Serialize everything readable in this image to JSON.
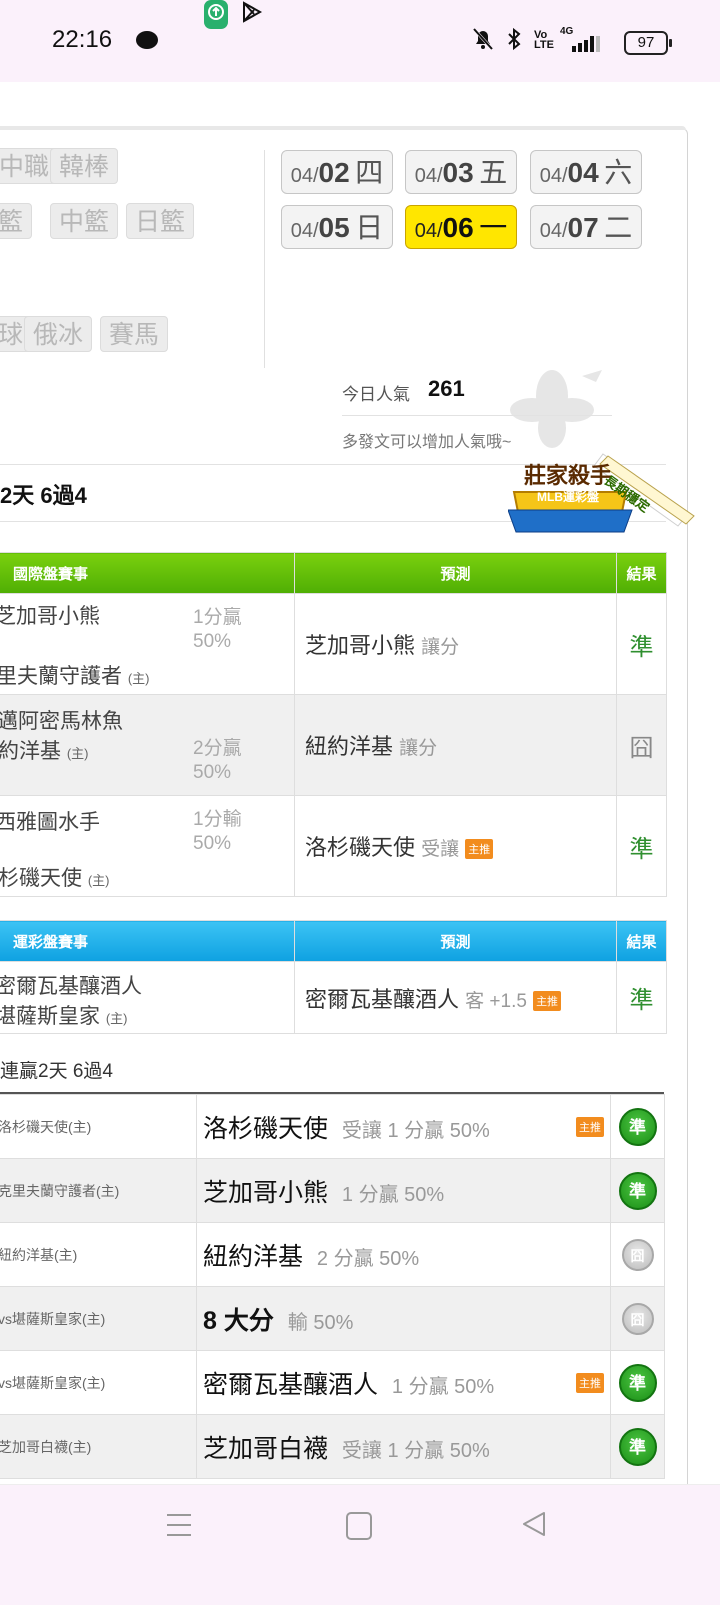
{
  "status_bar": {
    "time": "22:16",
    "battery": "97",
    "network": "4G",
    "icons": [
      "chat-bubble-icon",
      "app-green-icon",
      "upload-icon",
      "play-store-icon",
      "mute-icon",
      "bluetooth-icon",
      "volte-icon",
      "signal-icon",
      "battery-icon"
    ]
  },
  "league_tags": [
    {
      "label": "中職"
    },
    {
      "label": "韓棒"
    },
    {
      "label": "美籃"
    },
    {
      "label": "中籃"
    },
    {
      "label": "日籃"
    },
    {
      "label": "冰球"
    },
    {
      "label": "俄冰"
    },
    {
      "label": "賽馬"
    }
  ],
  "dates": [
    {
      "month": "04/",
      "day": "02",
      "weekday": "四",
      "active": false
    },
    {
      "month": "04/",
      "day": "03",
      "weekday": "五",
      "active": false
    },
    {
      "month": "04/",
      "day": "04",
      "weekday": "六",
      "active": false
    },
    {
      "month": "04/",
      "day": "05",
      "weekday": "日",
      "active": false
    },
    {
      "month": "04/",
      "day": "06",
      "weekday": "一",
      "active": true
    },
    {
      "month": "04/",
      "day": "07",
      "weekday": "二",
      "active": false
    }
  ],
  "popularity": {
    "label": "今日人氣",
    "value": "261",
    "hint": "多發文可以增加人氣哦~"
  },
  "streak": "2天 6過4",
  "badge": {
    "title": "莊家殺手",
    "subtitle": "MLB運彩盤",
    "ribbon": "長期穩定"
  },
  "intl_table": {
    "headers": [
      "國際盤賽事",
      "預測",
      "結果"
    ],
    "rows": [
      {
        "team1": "芝加哥小熊",
        "team2": "克里夫蘭守護者",
        "home": "(主)",
        "odds1": "1分贏",
        "odds2": "50%",
        "pick": "芝加哥小熊",
        "pick_sub": "讓分",
        "hot": "",
        "result": "準"
      },
      {
        "team1": "邁阿密馬林魚",
        "team2": "紐約洋基",
        "home": "(主)",
        "odds1": "2分贏",
        "odds2": "50%",
        "pick": "紐約洋基",
        "pick_sub": "讓分",
        "hot": "",
        "result": "囧"
      },
      {
        "team1": "西雅圖水手",
        "team2": "洛杉磯天使",
        "home": "(主)",
        "odds1": "1分輸",
        "odds2": "50%",
        "pick": "洛杉磯天使",
        "pick_sub": "受讓",
        "hot": "主推",
        "result": "準"
      }
    ]
  },
  "sports_table": {
    "headers": [
      "運彩盤賽事",
      "預測",
      "結果"
    ],
    "rows": [
      {
        "team1": "密爾瓦基釀酒人",
        "team2": "堪薩斯皇家",
        "home": "(主)",
        "pick": "密爾瓦基釀酒人",
        "pick_sub": "客 +1.5",
        "hot": "主推",
        "result": "準"
      }
    ]
  },
  "history": {
    "title": "連贏2天 6過4",
    "rows": [
      {
        "game": "洛杉磯天使(主)",
        "pick": "洛杉磯天使",
        "sub": "受讓 1 分贏 50%",
        "hot": "主推",
        "result": "準",
        "win": true
      },
      {
        "game": "克里夫蘭守護者(主)",
        "pick": "芝加哥小熊",
        "sub": "1 分贏 50%",
        "hot": "",
        "result": "準",
        "win": true
      },
      {
        "game": "紐約洋基(主)",
        "pick": "紐約洋基",
        "sub": "2 分贏 50%",
        "hot": "",
        "result": "囧",
        "win": false
      },
      {
        "game": "vs堪薩斯皇家(主)",
        "pick": "8 大分",
        "sub": "輸 50%",
        "hot": "",
        "result": "囧",
        "win": false
      },
      {
        "game": "vs堪薩斯皇家(主)",
        "pick": "密爾瓦基釀酒人",
        "sub": "1 分贏 50%",
        "hot": "主推",
        "result": "準",
        "win": true
      },
      {
        "game": "芝加哥白襪(主)",
        "pick": "芝加哥白襪",
        "sub": "受讓 1 分贏 50%",
        "hot": "",
        "result": "準",
        "win": true
      }
    ]
  },
  "nav": [
    "menu-icon",
    "home-icon",
    "back-icon"
  ]
}
